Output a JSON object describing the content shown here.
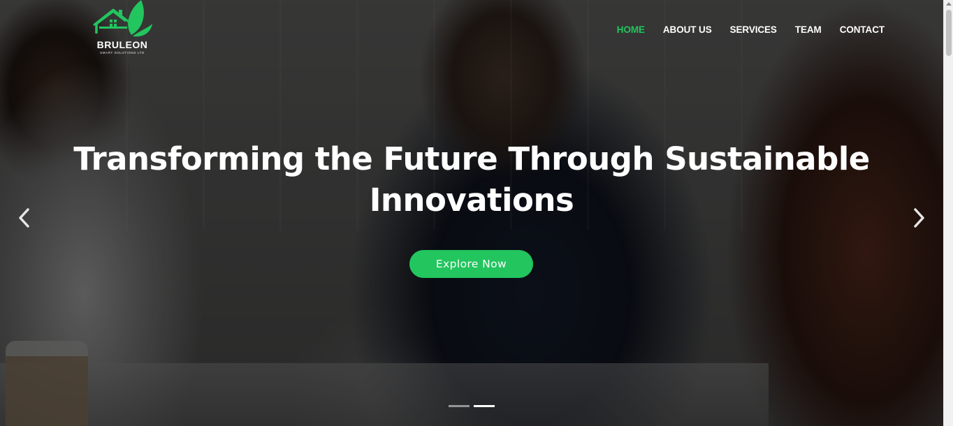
{
  "brand": {
    "name": "BRULEON",
    "tagline": "SMART SOLUTIONS LTD",
    "accent_color": "#22c55e",
    "logo_icon": "house-leaf-icon"
  },
  "nav": {
    "items": [
      {
        "label": "HOME",
        "active": true
      },
      {
        "label": "ABOUT US",
        "active": false
      },
      {
        "label": "SERVICES",
        "active": false
      },
      {
        "label": "TEAM",
        "active": false
      },
      {
        "label": "CONTACT",
        "active": false
      }
    ]
  },
  "hero": {
    "title": "Transforming the Future Through Sustainable Innovations",
    "cta_label": "Explore Now",
    "background_description_icon": "meeting-photo"
  },
  "carousel": {
    "prev_icon": "chevron-left-icon",
    "next_icon": "chevron-right-icon",
    "slide_count": 2,
    "active_slide": 2
  }
}
